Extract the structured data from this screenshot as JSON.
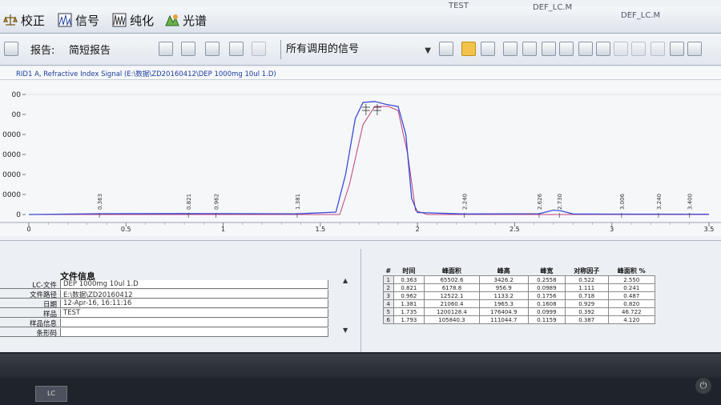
{
  "mode_bar": {
    "tabs": [
      {
        "label": "校正",
        "icon": "scale-icon"
      },
      {
        "label": "信号",
        "icon": "signal-icon"
      },
      {
        "label": "纯化",
        "icon": "purify-icon"
      },
      {
        "label": "光谱",
        "icon": "spectrum-icon"
      }
    ],
    "title_fragments": [
      "TEST",
      "DEF_LC.M",
      "DEF_LC.M"
    ]
  },
  "toolbar": {
    "report_label": "报告:",
    "report_value": "简短报告",
    "signal_select": "所有调用的信号"
  },
  "chart": {
    "title": "RID1 A, Refractive Index Signal (E:\\数据\\ZD20160412\\DEP  1000mg  10ul 1.D)",
    "colors": {
      "signal": "#3a4bd6",
      "baseline": "#c0407a"
    },
    "chart_data": {
      "type": "line",
      "xlim": [
        0,
        3.5
      ],
      "ylim": [
        0,
        60000
      ],
      "x_ticks": [
        "0",
        "0.5",
        "1",
        "1.5",
        "2",
        "2.5",
        "3",
        "3.5"
      ],
      "y_ticks": [
        "0",
        "0000",
        "0000",
        "0000",
        "0000",
        "00",
        "00"
      ],
      "peak_labels": [
        {
          "x": 0.363,
          "label": "0.363"
        },
        {
          "x": 0.821,
          "label": "0.821"
        },
        {
          "x": 0.962,
          "label": "0.962"
        },
        {
          "x": 1.381,
          "label": "1.381"
        },
        {
          "x": 2.24,
          "label": "2.240"
        },
        {
          "x": 2.626,
          "label": "2.626"
        },
        {
          "x": 2.73,
          "label": "2.730"
        },
        {
          "x": 3.05,
          "label": "3.006"
        },
        {
          "x": 3.24,
          "label": "3.240"
        },
        {
          "x": 3.4,
          "label": "3.400"
        }
      ],
      "signal": [
        [
          0,
          0
        ],
        [
          0.363,
          400
        ],
        [
          0.821,
          500
        ],
        [
          0.962,
          450
        ],
        [
          1.381,
          350
        ],
        [
          1.58,
          1200
        ],
        [
          1.63,
          20000
        ],
        [
          1.68,
          48000
        ],
        [
          1.72,
          56000
        ],
        [
          1.78,
          56500
        ],
        [
          1.84,
          55000
        ],
        [
          1.9,
          54000
        ],
        [
          1.94,
          40000
        ],
        [
          1.97,
          8000
        ],
        [
          2.0,
          1000
        ],
        [
          2.24,
          300
        ],
        [
          2.626,
          400
        ],
        [
          2.7,
          2200
        ],
        [
          2.74,
          1800
        ],
        [
          2.8,
          300
        ],
        [
          3.0,
          200
        ],
        [
          3.5,
          150
        ]
      ],
      "baseline": [
        [
          0,
          0
        ],
        [
          1.6,
          0
        ],
        [
          1.65,
          15000
        ],
        [
          1.72,
          45000
        ],
        [
          1.78,
          54000
        ],
        [
          1.85,
          54000
        ],
        [
          1.9,
          52000
        ],
        [
          1.95,
          30000
        ],
        [
          1.99,
          2000
        ],
        [
          2.05,
          0
        ],
        [
          3.5,
          0
        ]
      ]
    }
  },
  "file_info": {
    "title": "文件信息",
    "rows": [
      {
        "key": "LC-文件",
        "value": "DEP  1000mg  10ul 1.D"
      },
      {
        "key": "文件路径",
        "value": "E:\\数据\\ZD20160412"
      },
      {
        "key": "日期",
        "value": "12-Apr-16, 16:11:16"
      },
      {
        "key": "样品",
        "value": "TEST"
      },
      {
        "key": "样品信息",
        "value": ""
      },
      {
        "key": "条形码",
        "value": ""
      }
    ]
  },
  "peak_table": {
    "headers": [
      "#",
      "时间",
      "峰面积",
      "峰高",
      "峰宽",
      "对称因子",
      "峰面积 %"
    ],
    "rows": [
      [
        "1",
        "0.363",
        "65502.6",
        "3426.2",
        "0.2558",
        "0.522",
        "2.550"
      ],
      [
        "2",
        "0.821",
        "6178.8",
        "956.9",
        "0.0989",
        "1.111",
        "0.241"
      ],
      [
        "3",
        "0.962",
        "12522.1",
        "1133.2",
        "0.1756",
        "0.718",
        "0.487"
      ],
      [
        "4",
        "1.381",
        "21060.4",
        "1965.3",
        "0.1608",
        "0.929",
        "0.820"
      ],
      [
        "5",
        "1.735",
        "1200128.4",
        "176404.9",
        "0.0999",
        "0.392",
        "46.722"
      ],
      [
        "6",
        "1.793",
        "105840.3",
        "111044.7",
        "0.1159",
        "0.387",
        "4.120"
      ]
    ]
  },
  "taskbar": {
    "button_label": "LC"
  }
}
